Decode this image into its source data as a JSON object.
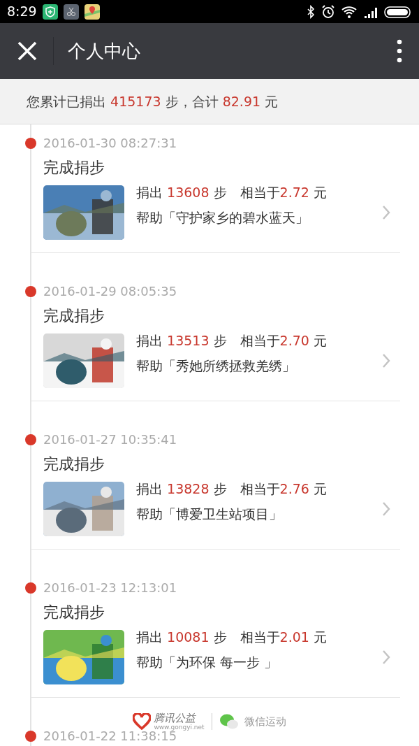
{
  "status_bar": {
    "time": "8:29"
  },
  "header": {
    "title": "个人中心"
  },
  "summary": {
    "parts": [
      "您累计已捐出 ",
      "415173",
      " 步，合计 ",
      "82.91",
      " 元"
    ]
  },
  "entries": [
    {
      "date": "2016-01-30 08:27:31",
      "title": "完成捐步",
      "donated": "捐出",
      "steps": "13608",
      "steps_unit": "步",
      "equals": "相当于",
      "amount": "2.72",
      "currency": "元",
      "project": "帮助「守护家乡的碧水蓝天」"
    },
    {
      "date": "2016-01-29 08:05:35",
      "title": "完成捐步",
      "donated": "捐出",
      "steps": "13513",
      "steps_unit": "步",
      "equals": "相当于",
      "amount": "2.70",
      "currency": "元",
      "project": "帮助「秀她所绣拯救羌绣」"
    },
    {
      "date": "2016-01-27 10:35:41",
      "title": "完成捐步",
      "donated": "捐出",
      "steps": "13828",
      "steps_unit": "步",
      "equals": "相当于",
      "amount": "2.76",
      "currency": "元",
      "project": "帮助「博爱卫生站项目」"
    },
    {
      "date": "2016-01-23 12:13:01",
      "title": "完成捐步",
      "donated": "捐出",
      "steps": "10081",
      "steps_unit": "步",
      "equals": "相当于",
      "amount": "2.01",
      "currency": "元",
      "project": "帮助「为环保 每一步 」"
    },
    {
      "date": "2016-01-22 11:38:15"
    }
  ],
  "footer": {
    "brand": "腾讯公益",
    "url": "www.gongyi.net",
    "app": "微信运动"
  }
}
